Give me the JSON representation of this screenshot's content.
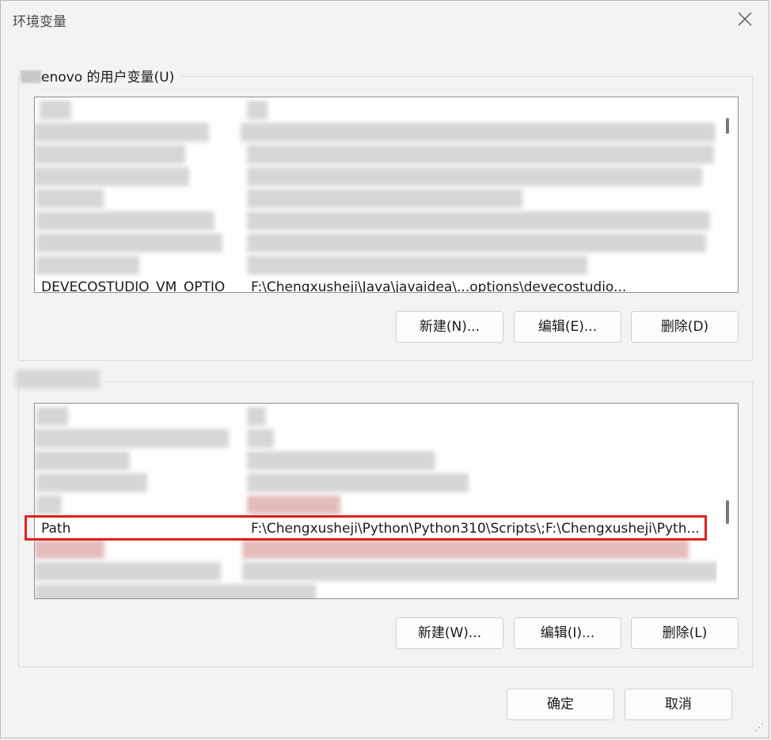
{
  "window": {
    "title": "环境变量",
    "close_icon": "close-icon"
  },
  "user_vars": {
    "group_label": "enovo 的用户变量(U)",
    "visible_row": {
      "name": "DEVECOSTUDIO_VM_OPTIO",
      "value": "F:\\Chengxusheji\\Java\\javaidea\\...options\\devecostudio..."
    },
    "buttons": {
      "new": "新建(N)...",
      "edit": "编辑(E)...",
      "delete": "删除(D)"
    }
  },
  "system_vars": {
    "selected_row": {
      "name": "Path",
      "value": "F:\\Chengxusheji\\Python\\Python310\\Scripts\\;F:\\Chengxusheji\\Pyth..."
    },
    "buttons": {
      "new": "新建(W)...",
      "edit": "编辑(I)...",
      "delete": "删除(L)"
    }
  },
  "footer": {
    "ok": "确定",
    "cancel": "取消"
  },
  "colors": {
    "highlight": "#e0201c",
    "background": "#f3f3f3"
  }
}
